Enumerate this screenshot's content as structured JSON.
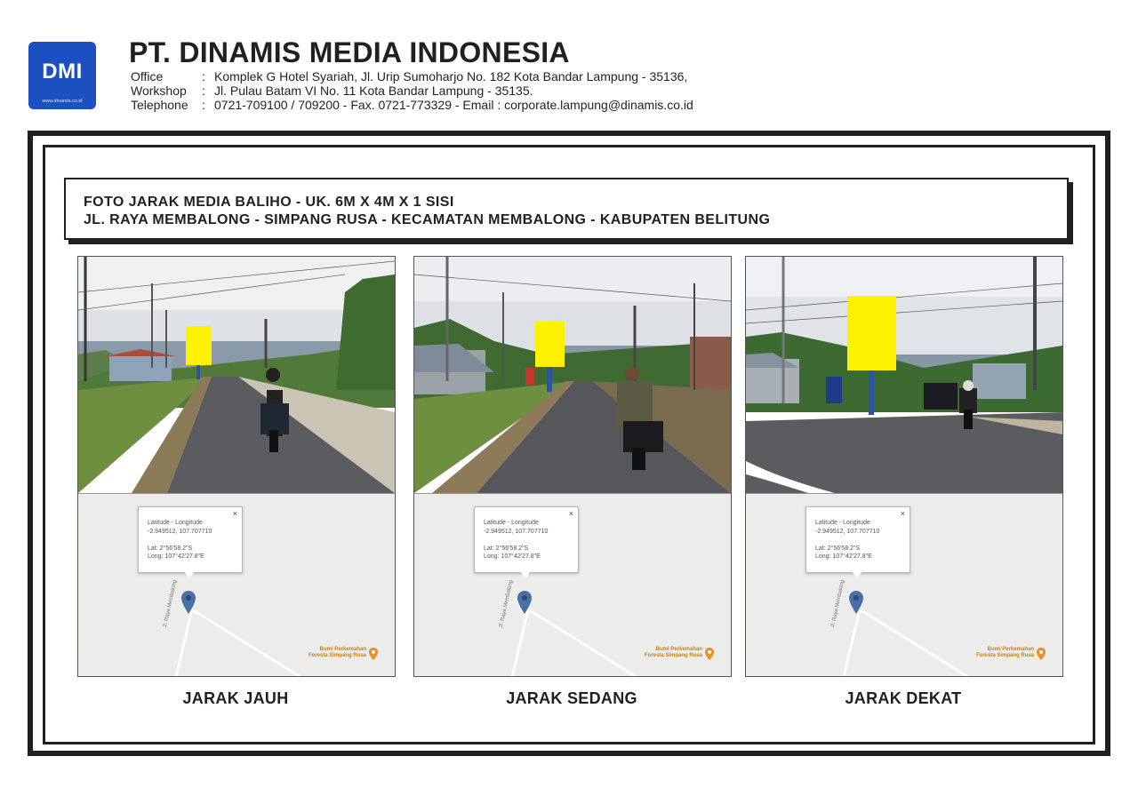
{
  "header": {
    "logo_text": "DMI",
    "logo_url": "www.dinamis.co.id",
    "company": "PT. DINAMIS MEDIA INDONESIA",
    "rows": [
      {
        "key": "Office",
        "value": "Komplek G Hotel Syariah, Jl. Urip  Sumoharjo No. 182 Kota Bandar Lampung - 35136,"
      },
      {
        "key": "Workshop",
        "value": "Jl. Pulau Batam  VI  No. 11 Kota Bandar Lampung - 35135."
      },
      {
        "key": "Telephone",
        "value": "0721-709100 / 709200 - Fax. 0721-773329 - Email : corporate.lampung@dinamis.co.id"
      }
    ]
  },
  "title": {
    "line1": "FOTO JARAK MEDIA BALIHO - UK. 6M X 4M X 1 SISI",
    "line2": "JL. RAYA MEMBALONG - SIMPANG RUSA - KECAMATAN MEMBALONG - KABUPATEN BELITUNG"
  },
  "map_popup": {
    "label": "Latitude - Longitude",
    "coords": "-2.949512, 107.707710",
    "lat": "Lat: 2°56'58.2\"S",
    "long": "Long: 107°42'27.8\"E",
    "close": "×"
  },
  "map_road_label": "Jl. Raya Membalong",
  "map_poi": {
    "line1": "Bumi Perkemahan",
    "line2": "Foresta Simpang Rusa"
  },
  "colors": {
    "logo_bg": "#1c4fc0",
    "billboard": "#fff200",
    "pin": "#4a6fa5",
    "poi": "#c9801a",
    "frame": "#231f20"
  },
  "panels": [
    {
      "caption": "JARAK JAUH"
    },
    {
      "caption": "JARAK SEDANG"
    },
    {
      "caption": "JARAK DEKAT"
    }
  ]
}
